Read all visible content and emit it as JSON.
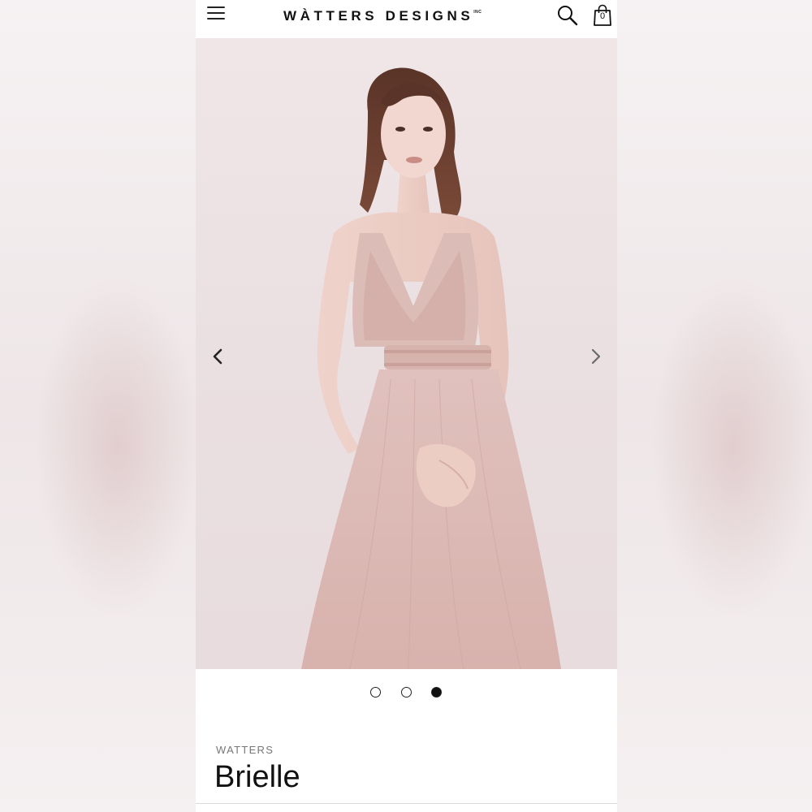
{
  "header": {
    "logo_text": "WÀTTERS DESIGNS",
    "logo_suffix": "INC",
    "cart_count": "0",
    "menu_icon": "hamburger-icon",
    "search_icon": "search-icon",
    "bag_icon": "shopping-bag-icon"
  },
  "gallery": {
    "image_count": 3,
    "active_index": 2,
    "prev_icon": "chevron-left-icon",
    "next_icon": "chevron-right-icon",
    "dress_color": "#e3c3c0"
  },
  "product": {
    "brand": "WATTERS",
    "name": "Brielle"
  },
  "colors": {
    "background": "#ffffff",
    "text": "#111111",
    "muted": "#777777"
  }
}
